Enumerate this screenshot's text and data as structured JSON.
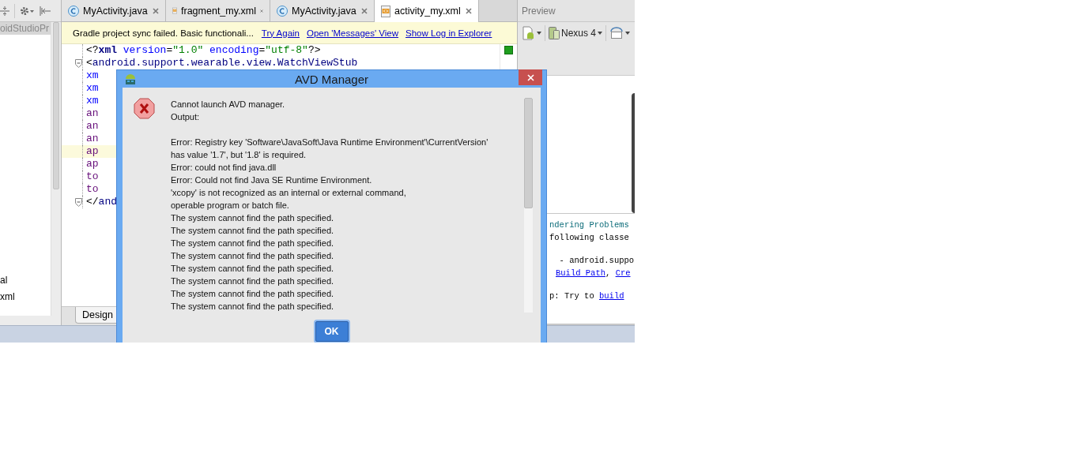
{
  "project_panel": {
    "items": [
      {
        "label": "oidStudioPr",
        "selected": true
      },
      {
        "label": "al",
        "selected": false
      },
      {
        "label": "xml",
        "selected": false
      }
    ]
  },
  "editor_tabs": [
    {
      "label": "MyActivity.java",
      "kind": "java",
      "selected": false
    },
    {
      "label": "fragment_my.xml",
      "kind": "xml",
      "selected": false
    },
    {
      "label": "MyActivity.java",
      "kind": "java",
      "selected": false
    },
    {
      "label": "activity_my.xml",
      "kind": "xml",
      "selected": true
    }
  ],
  "banner": {
    "message": "Gradle project sync failed. Basic functionali...",
    "links": [
      "Try Again",
      "Open 'Messages' View",
      "Show Log in Explorer"
    ]
  },
  "code_lines": [
    {
      "highlighted": false,
      "fold": false,
      "segments": [
        {
          "kind": "punct",
          "text": "<?"
        },
        {
          "kind": "tag",
          "text": "xml"
        },
        {
          "kind": "attr",
          "text": " version"
        },
        {
          "kind": "punct",
          "text": "="
        },
        {
          "kind": "value",
          "text": "\"1.0\""
        },
        {
          "kind": "attr",
          "text": " encoding"
        },
        {
          "kind": "punct",
          "text": "="
        },
        {
          "kind": "value",
          "text": "\"utf-8\""
        },
        {
          "kind": "punct",
          "text": "?>"
        }
      ]
    },
    {
      "highlighted": false,
      "fold": true,
      "segments": [
        {
          "kind": "punct",
          "text": "<"
        },
        {
          "kind": "tag",
          "text": "android.support.wearable.view.WatchViewStub"
        }
      ]
    },
    {
      "highlighted": false,
      "fold": false,
      "segments": [
        {
          "kind": "ns",
          "text": "xm"
        }
      ]
    },
    {
      "highlighted": false,
      "fold": false,
      "segments": [
        {
          "kind": "ns",
          "text": "xm"
        }
      ]
    },
    {
      "highlighted": false,
      "fold": false,
      "segments": [
        {
          "kind": "ns",
          "text": "xm"
        }
      ]
    },
    {
      "highlighted": false,
      "fold": false,
      "segments": [
        {
          "kind": "prop",
          "text": "an"
        }
      ]
    },
    {
      "highlighted": false,
      "fold": false,
      "segments": [
        {
          "kind": "prop",
          "text": "an"
        }
      ]
    },
    {
      "highlighted": false,
      "fold": false,
      "segments": [
        {
          "kind": "prop",
          "text": "an"
        }
      ]
    },
    {
      "highlighted": true,
      "fold": false,
      "segments": [
        {
          "kind": "prop",
          "text": "ap"
        }
      ]
    },
    {
      "highlighted": false,
      "fold": false,
      "segments": [
        {
          "kind": "prop",
          "text": "ap"
        }
      ]
    },
    {
      "highlighted": false,
      "fold": false,
      "segments": [
        {
          "kind": "prop",
          "text": "to"
        }
      ]
    },
    {
      "highlighted": false,
      "fold": false,
      "segments": [
        {
          "kind": "prop",
          "text": "to"
        }
      ]
    },
    {
      "highlighted": false,
      "fold": true,
      "segments": [
        {
          "kind": "punct",
          "text": "</"
        },
        {
          "kind": "tag",
          "text": "and"
        }
      ]
    }
  ],
  "editor_bottom_tabs": [
    {
      "label": "Design",
      "selected": true
    }
  ],
  "preview": {
    "title": "Preview",
    "device": "Nexus 4",
    "render_lines": [
      [
        {
          "kind": "heading",
          "text": "ndering Problems"
        }
      ],
      [
        {
          "kind": "text",
          "text": "following classe"
        }
      ],
      [
        {
          "kind": "text",
          "text": "  - android.suppo"
        }
      ],
      [
        {
          "kind": "link",
          "text": "Build Path"
        },
        {
          "kind": "text",
          "text": ", "
        },
        {
          "kind": "link",
          "text": "Cre"
        }
      ],
      [
        {
          "kind": "text",
          "text": "p: Try to "
        },
        {
          "kind": "link",
          "text": "build"
        }
      ]
    ]
  },
  "dialog": {
    "title": "AVD Manager",
    "heading": [
      "Cannot launch AVD manager.",
      "Output:"
    ],
    "output_lines": [
      "Error: Registry key 'Software\\JavaSoft\\Java Runtime Environment'\\CurrentVersion'",
      "has value '1.7', but '1.8' is required.",
      "Error: could not find java.dll",
      "Error: Could not find Java SE Runtime Environment.",
      "'xcopy' is not recognized as an internal or external command,",
      "operable program or batch file.",
      "The system cannot find the path specified.",
      "The system cannot find the path specified.",
      "The system cannot find the path specified.",
      "The system cannot find the path specified.",
      "The system cannot find the path specified.",
      "The system cannot find the path specified.",
      "The system cannot find the path specified.",
      "The system cannot find the path specified."
    ],
    "ok_button": "OK"
  }
}
